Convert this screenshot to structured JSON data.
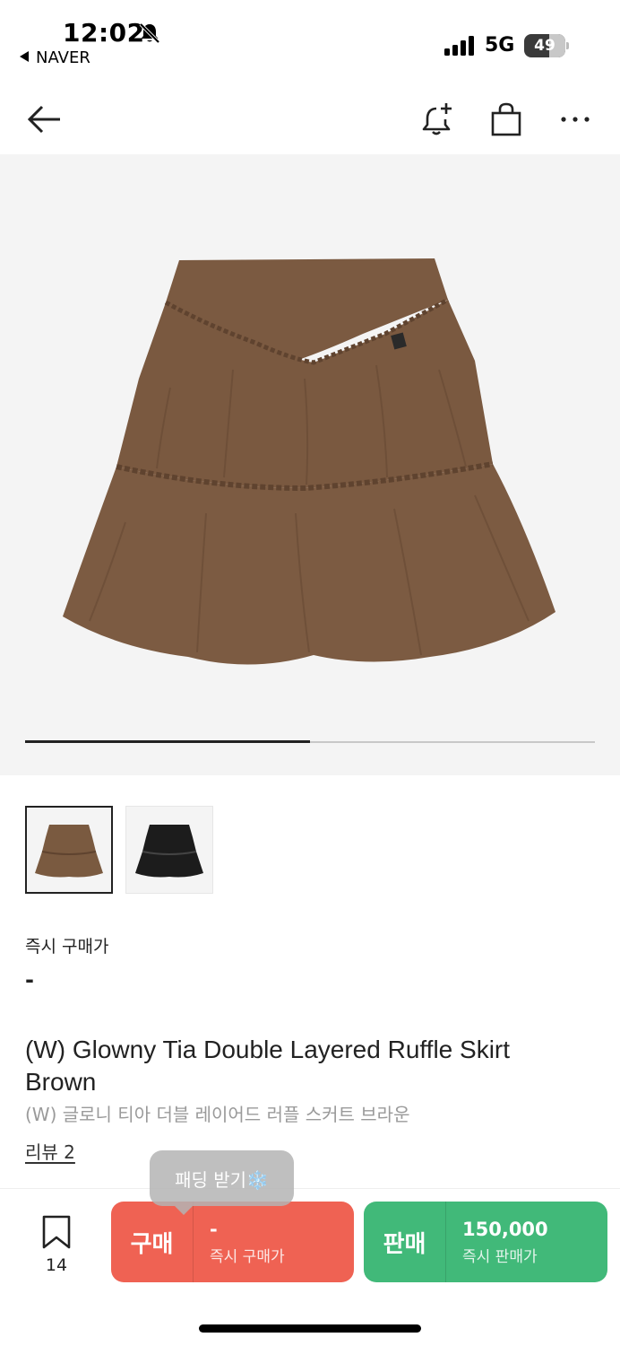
{
  "status_bar": {
    "time": "12:02",
    "back_app": "NAVER",
    "network": "5G",
    "battery": "49",
    "icons": [
      "bell-slash-icon",
      "signal-icon",
      "battery-icon"
    ]
  },
  "nav": {
    "icons": [
      "back-arrow-icon",
      "bell-plus-icon",
      "shopping-bag-icon",
      "more-icon"
    ]
  },
  "gallery": {
    "progress_fraction": 0.5,
    "thumbnails": [
      {
        "name": "brown-skirt",
        "color": "#7a5a40",
        "selected": true
      },
      {
        "name": "black-skirt",
        "color": "#1c1c1c",
        "selected": false
      }
    ]
  },
  "product": {
    "price_label": "즉시 구매가",
    "price_value": "-",
    "title_en": "(W) Glowny Tia Double Layered Ruffle Skirt Brown",
    "title_ko": "(W) 글로니 티아 더블 레이어드 러플 스커트 브라운",
    "review": "리뷰 2"
  },
  "tooltip": {
    "text": "패딩 받기❄️"
  },
  "actions": {
    "wish_count": "14",
    "buy": {
      "label": "구매",
      "price": "-",
      "sub": "즉시 구매가",
      "color": "#ef6253"
    },
    "sell": {
      "label": "판매",
      "price": "150,000",
      "sub": "즉시 판매가",
      "color": "#41b979"
    }
  }
}
